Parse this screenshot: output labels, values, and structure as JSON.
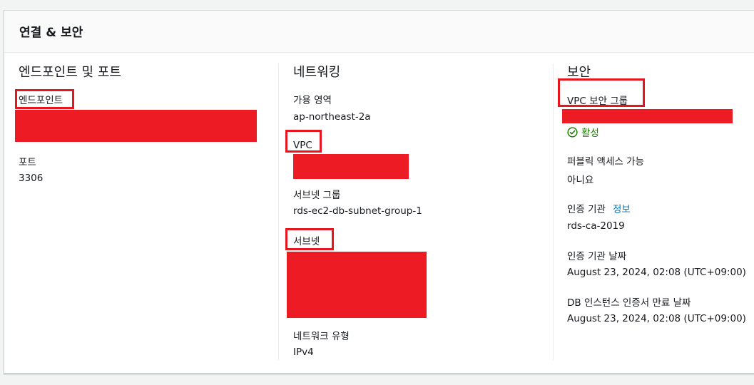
{
  "panel": {
    "title": "연결 & 보안"
  },
  "endpoint_port": {
    "title": "엔드포인트 및 포트",
    "endpoint_label": "엔드포인트",
    "port_label": "포트",
    "port_value": "3306"
  },
  "networking": {
    "title": "네트워킹",
    "az_label": "가용 영역",
    "az_value": "ap-northeast-2a",
    "vpc_label": "VPC",
    "subnet_group_label": "서브넷 그룹",
    "subnet_group_value": "rds-ec2-db-subnet-group-1",
    "subnet_label": "서브넷",
    "network_type_label": "네트워크 유형",
    "network_type_value": "IPv4"
  },
  "security": {
    "title": "보안",
    "vpc_sg_label": "VPC 보안 그룹",
    "sg_status": "활성",
    "public_access_label": "퍼블릭 액세스 가능",
    "public_access_value": "아니요",
    "ca_label": "인증 기관",
    "ca_info_link": "정보",
    "ca_value": "rds-ca-2019",
    "ca_date_label": "인증 기관 날짜",
    "ca_date_value": "August 23, 2024, 02:08 (UTC+09:00)",
    "cert_expiry_label": "DB 인스턴스 인증서 만료 날짜",
    "cert_expiry_value": "August 23, 2024, 02:08 (UTC+09:00)"
  },
  "colors": {
    "highlight_border": "#e4161e",
    "redaction": "#ed1c24",
    "link": "#0073bb",
    "success": "#1d8102"
  }
}
